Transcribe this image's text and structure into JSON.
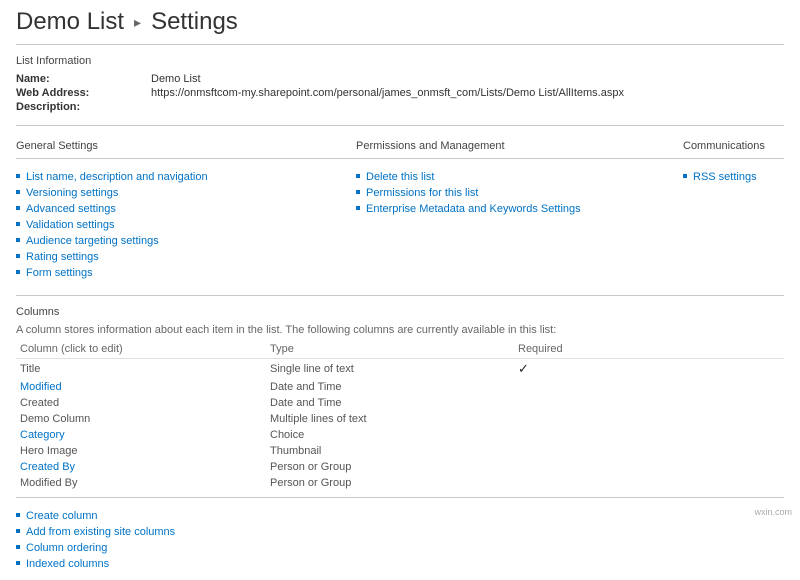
{
  "breadcrumb": {
    "parent": "Demo List",
    "arrow_glyph": "▸",
    "current": "Settings"
  },
  "list_info": {
    "heading": "List Information",
    "rows": [
      {
        "label": "Name:",
        "value": "Demo List"
      },
      {
        "label": "Web Address:",
        "value": "https://onmsftcom-my.sharepoint.com/personal/james_onmsft_com/Lists/Demo List/AllItems.aspx"
      },
      {
        "label": "Description:",
        "value": ""
      }
    ]
  },
  "general": {
    "heading": "General Settings",
    "links": [
      "List name, description and navigation",
      "Versioning settings",
      "Advanced settings",
      "Validation settings",
      "Audience targeting settings",
      "Rating settings",
      "Form settings"
    ]
  },
  "permissions": {
    "heading": "Permissions and Management",
    "links": [
      "Delete this list",
      "Permissions for this list",
      "Enterprise Metadata and Keywords Settings"
    ]
  },
  "communications": {
    "heading": "Communications",
    "links": [
      "RSS settings"
    ]
  },
  "columns": {
    "heading": "Columns",
    "description": "A column stores information about each item in the list. The following columns are currently available in this list:",
    "headers": {
      "name": "Column (click to edit)",
      "type": "Type",
      "required": "Required"
    },
    "rows": [
      {
        "name": "Title",
        "is_link": false,
        "type": "Single line of text",
        "required": true
      },
      {
        "name": "Modified",
        "is_link": true,
        "type": "Date and Time",
        "required": false
      },
      {
        "name": "Created",
        "is_link": false,
        "type": "Date and Time",
        "required": false
      },
      {
        "name": "Demo Column",
        "is_link": false,
        "type": "Multiple lines of text",
        "required": false
      },
      {
        "name": "Category",
        "is_link": true,
        "type": "Choice",
        "required": false
      },
      {
        "name": "Hero Image",
        "is_link": false,
        "type": "Thumbnail",
        "required": false
      },
      {
        "name": "Created By",
        "is_link": true,
        "type": "Person or Group",
        "required": false
      },
      {
        "name": "Modified By",
        "is_link": false,
        "type": "Person or Group",
        "required": false
      }
    ],
    "actions": [
      "Create column",
      "Add from existing site columns",
      "Column ordering",
      "Indexed columns"
    ],
    "check_glyph": "✓"
  },
  "watermark": "wxin.com"
}
